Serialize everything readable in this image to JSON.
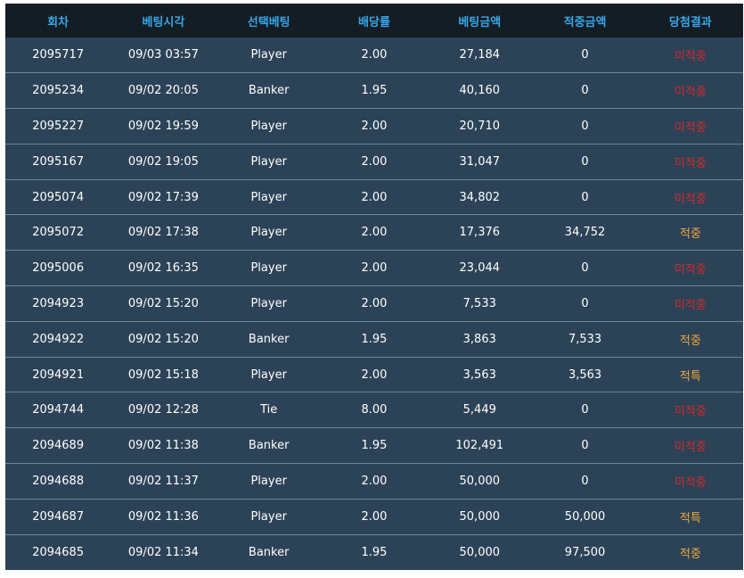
{
  "header": {
    "columns": [
      "회차",
      "베팅시각",
      "선택베팅",
      "배당률",
      "베팅금액",
      "적중금액",
      "당첨결과"
    ]
  },
  "rows": [
    {
      "round": "2095717",
      "time": "09/03 03:57",
      "bet": "Player",
      "odds": "2.00",
      "amount": "27,184",
      "win_amount": "0",
      "result": "미적중",
      "result_type": "lose"
    },
    {
      "round": "2095234",
      "time": "09/02 20:05",
      "bet": "Banker",
      "odds": "1.95",
      "amount": "40,160",
      "win_amount": "0",
      "result": "미적중",
      "result_type": "lose"
    },
    {
      "round": "2095227",
      "time": "09/02 19:59",
      "bet": "Player",
      "odds": "2.00",
      "amount": "20,710",
      "win_amount": "0",
      "result": "미적중",
      "result_type": "lose"
    },
    {
      "round": "2095167",
      "time": "09/02 19:05",
      "bet": "Player",
      "odds": "2.00",
      "amount": "31,047",
      "win_amount": "0",
      "result": "미적중",
      "result_type": "lose"
    },
    {
      "round": "2095074",
      "time": "09/02 17:39",
      "bet": "Player",
      "odds": "2.00",
      "amount": "34,802",
      "win_amount": "0",
      "result": "미적중",
      "result_type": "lose"
    },
    {
      "round": "2095072",
      "time": "09/02 17:38",
      "bet": "Player",
      "odds": "2.00",
      "amount": "17,376",
      "win_amount": "34,752",
      "result": "적중",
      "result_type": "win"
    },
    {
      "round": "2095006",
      "time": "09/02 16:35",
      "bet": "Player",
      "odds": "2.00",
      "amount": "23,044",
      "win_amount": "0",
      "result": "미적중",
      "result_type": "lose"
    },
    {
      "round": "2094923",
      "time": "09/02 15:20",
      "bet": "Player",
      "odds": "2.00",
      "amount": "7,533",
      "win_amount": "0",
      "result": "미적중",
      "result_type": "lose"
    },
    {
      "round": "2094922",
      "time": "09/02 15:20",
      "bet": "Banker",
      "odds": "1.95",
      "amount": "3,863",
      "win_amount": "7,533",
      "result": "적중",
      "result_type": "win"
    },
    {
      "round": "2094921",
      "time": "09/02 15:18",
      "bet": "Player",
      "odds": "2.00",
      "amount": "3,563",
      "win_amount": "3,563",
      "result": "적특",
      "result_type": "win"
    },
    {
      "round": "2094744",
      "time": "09/02 12:28",
      "bet": "Tie",
      "odds": "8.00",
      "amount": "5,449",
      "win_amount": "0",
      "result": "미적중",
      "result_type": "lose"
    },
    {
      "round": "2094689",
      "time": "09/02 11:38",
      "bet": "Banker",
      "odds": "1.95",
      "amount": "102,491",
      "win_amount": "0",
      "result": "미적중",
      "result_type": "lose"
    },
    {
      "round": "2094688",
      "time": "09/02 11:37",
      "bet": "Player",
      "odds": "2.00",
      "amount": "50,000",
      "win_amount": "0",
      "result": "미적중",
      "result_type": "lose"
    },
    {
      "round": "2094687",
      "time": "09/02 11:36",
      "bet": "Player",
      "odds": "2.00",
      "amount": "50,000",
      "win_amount": "50,000",
      "result": "적특",
      "result_type": "win"
    },
    {
      "round": "2094685",
      "time": "09/02 11:34",
      "bet": "Banker",
      "odds": "1.95",
      "amount": "50,000",
      "win_amount": "97,500",
      "result": "적중",
      "result_type": "win"
    }
  ],
  "colors": {
    "header_bg": "#141c24",
    "header_text": "#38a6e8",
    "row_bg": "#2c4357",
    "row_divider": "#6e8594",
    "lose": "#d12a2a",
    "win": "#f2a63c"
  }
}
